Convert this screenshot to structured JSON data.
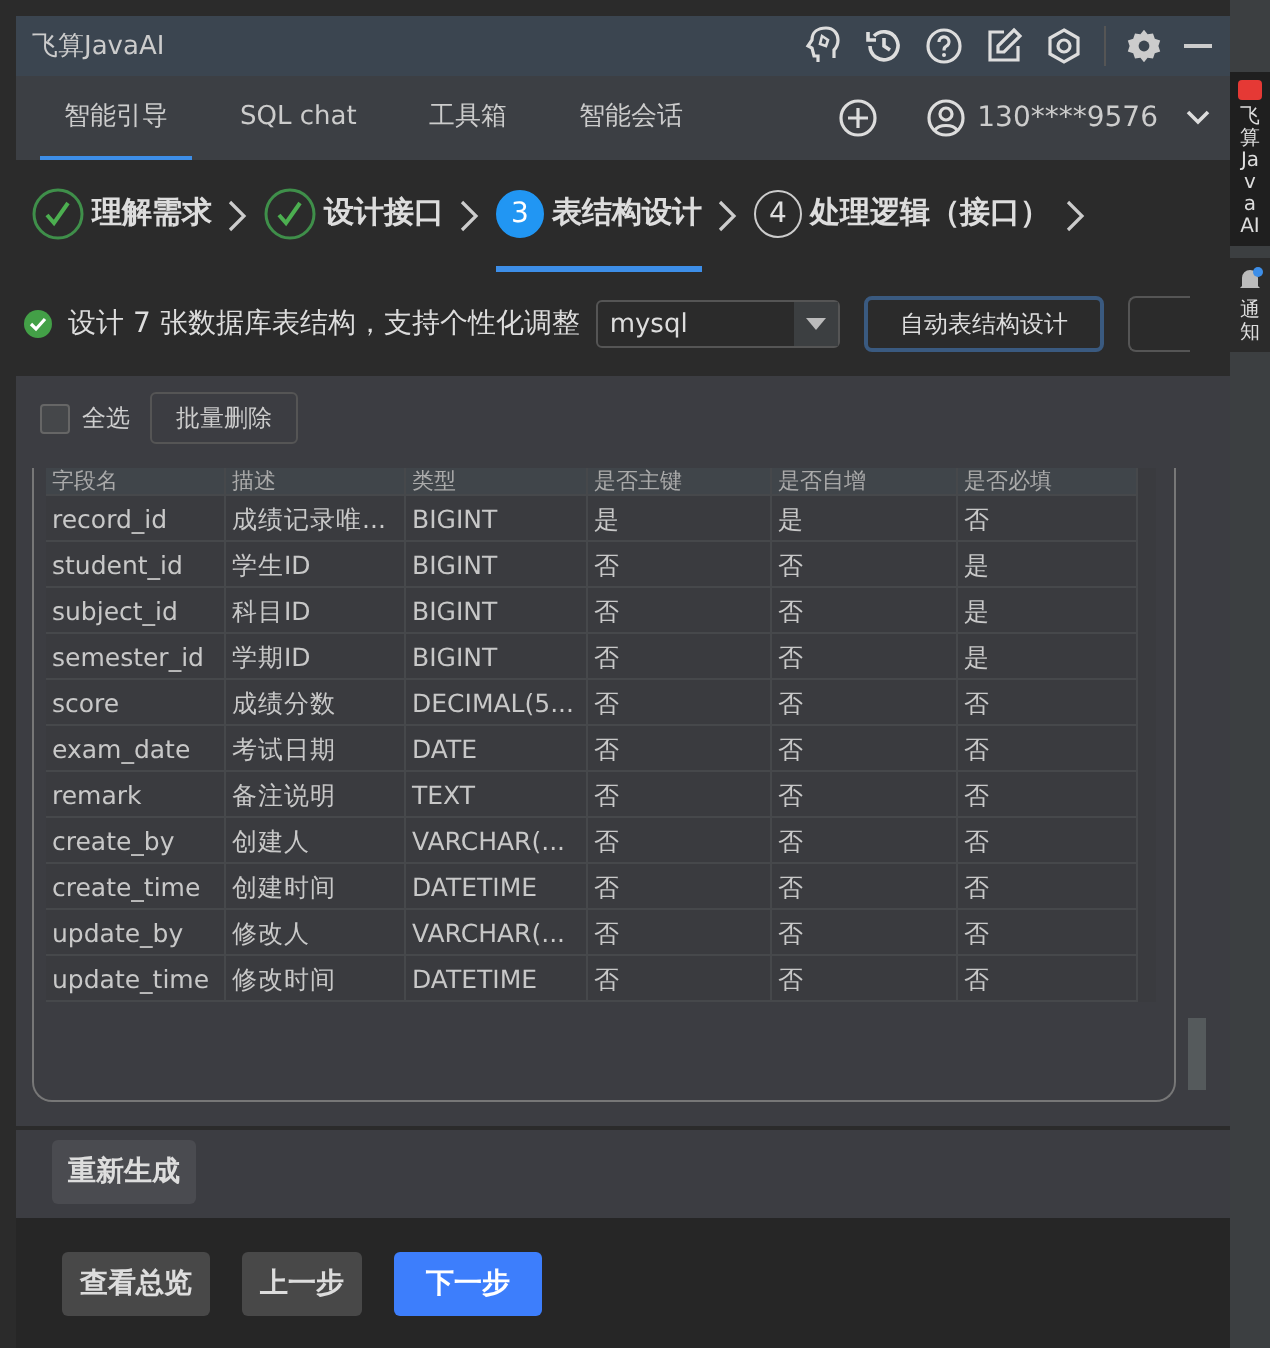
{
  "window": {
    "title": "飞算JavaAI"
  },
  "tabs": [
    {
      "label": "智能引导",
      "selected": true
    },
    {
      "label": "SQL chat",
      "selected": false
    },
    {
      "label": "工具箱",
      "selected": false
    },
    {
      "label": "智能会话",
      "selected": false
    }
  ],
  "account": {
    "phone": "130****9576"
  },
  "steps": [
    {
      "label": "理解需求",
      "completed": true,
      "selected": false
    },
    {
      "label": "设计接口",
      "completed": true,
      "selected": false
    },
    {
      "number": "3",
      "label": "表结构设计",
      "completed": false,
      "selected": true
    },
    {
      "number": "4",
      "label": "处理逻辑（接口）",
      "completed": false,
      "selected": false
    }
  ],
  "summary": "设计 7 张数据库表结构，支持个性化调整",
  "database": {
    "value": "mysql"
  },
  "auto_button": "自动表结构设计",
  "select_all": {
    "label": "全选",
    "checked": false
  },
  "batch_delete": "批量删除",
  "table": {
    "columns": [
      "字段名",
      "描述",
      "类型",
      "是否主键",
      "是否自增",
      "是否必填"
    ],
    "rows": [
      [
        "record_id",
        "成绩记录唯...",
        "BIGINT",
        "是",
        "是",
        "否"
      ],
      [
        "student_id",
        "学生ID",
        "BIGINT",
        "否",
        "否",
        "是"
      ],
      [
        "subject_id",
        "科目ID",
        "BIGINT",
        "否",
        "否",
        "是"
      ],
      [
        "semester_id",
        "学期ID",
        "BIGINT",
        "否",
        "否",
        "是"
      ],
      [
        "score",
        "成绩分数",
        "DECIMAL(5...",
        "否",
        "否",
        "否"
      ],
      [
        "exam_date",
        "考试日期",
        "DATE",
        "否",
        "否",
        "否"
      ],
      [
        "remark",
        "备注说明",
        "TEXT",
        "否",
        "否",
        "否"
      ],
      [
        "create_by",
        "创建人",
        "VARCHAR(...",
        "否",
        "否",
        "否"
      ],
      [
        "create_time",
        "创建时间",
        "DATETIME",
        "否",
        "否",
        "否"
      ],
      [
        "update_by",
        "修改人",
        "VARCHAR(...",
        "否",
        "否",
        "否"
      ],
      [
        "update_time",
        "修改时间",
        "DATETIME",
        "否",
        "否",
        "否"
      ]
    ]
  },
  "regenerate": "重新生成",
  "footer_buttons": [
    {
      "label": "查看总览",
      "kind": "secondary"
    },
    {
      "label": "上一步",
      "kind": "secondary"
    },
    {
      "label": "下一步",
      "kind": "primary"
    }
  ],
  "side_tabs": [
    {
      "label": "飞算JavaAI",
      "kind": "plugin"
    },
    {
      "label": "通知",
      "kind": "notice"
    }
  ]
}
